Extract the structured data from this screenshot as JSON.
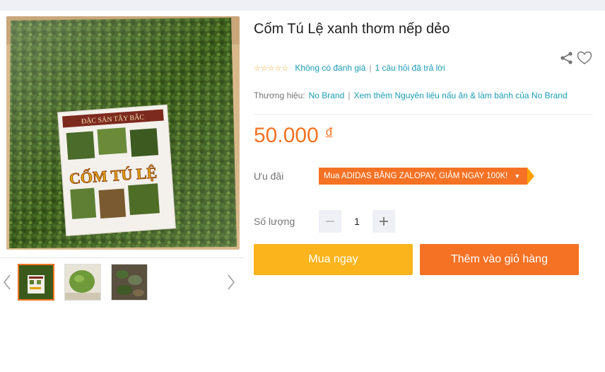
{
  "product": {
    "title": "Cốm Tú Lệ xanh thơm nếp dẻo",
    "rating_stars": "☆☆☆☆☆",
    "no_reviews": "Không có đánh giá",
    "questions": "1 câu hỏi đã trả lời",
    "brand_label": "Thương hiệu:",
    "brand_name": "No Brand",
    "more_from_brand": "Xem thêm Nguyên liệu nấu ăn & làm bánh của No Brand",
    "price": "50.000",
    "currency": "đ",
    "promo_label": "Ưu đãi",
    "promo_text": "Mua ADIDAS BẰNG ZALOPAY, GIẢM NGAY 100K!",
    "quantity_label": "Số lượng",
    "quantity": "1",
    "buy_now": "Mua ngay",
    "add_to_cart": "Thêm vào giỏ hàng"
  },
  "package_label": {
    "banner": "ĐẶC SẢN TÂY BẮC",
    "name": "CỐM TÚ LỆ"
  },
  "icons": {
    "share": "share-icon",
    "wishlist": "heart-icon",
    "prev": "chevron-left-icon",
    "next": "chevron-right-icon",
    "caret": "caret-down-icon"
  },
  "colors": {
    "accent": "#f57224",
    "buy_now": "#fbb41b",
    "link": "#1a9cb7",
    "star": "#f5a623"
  }
}
